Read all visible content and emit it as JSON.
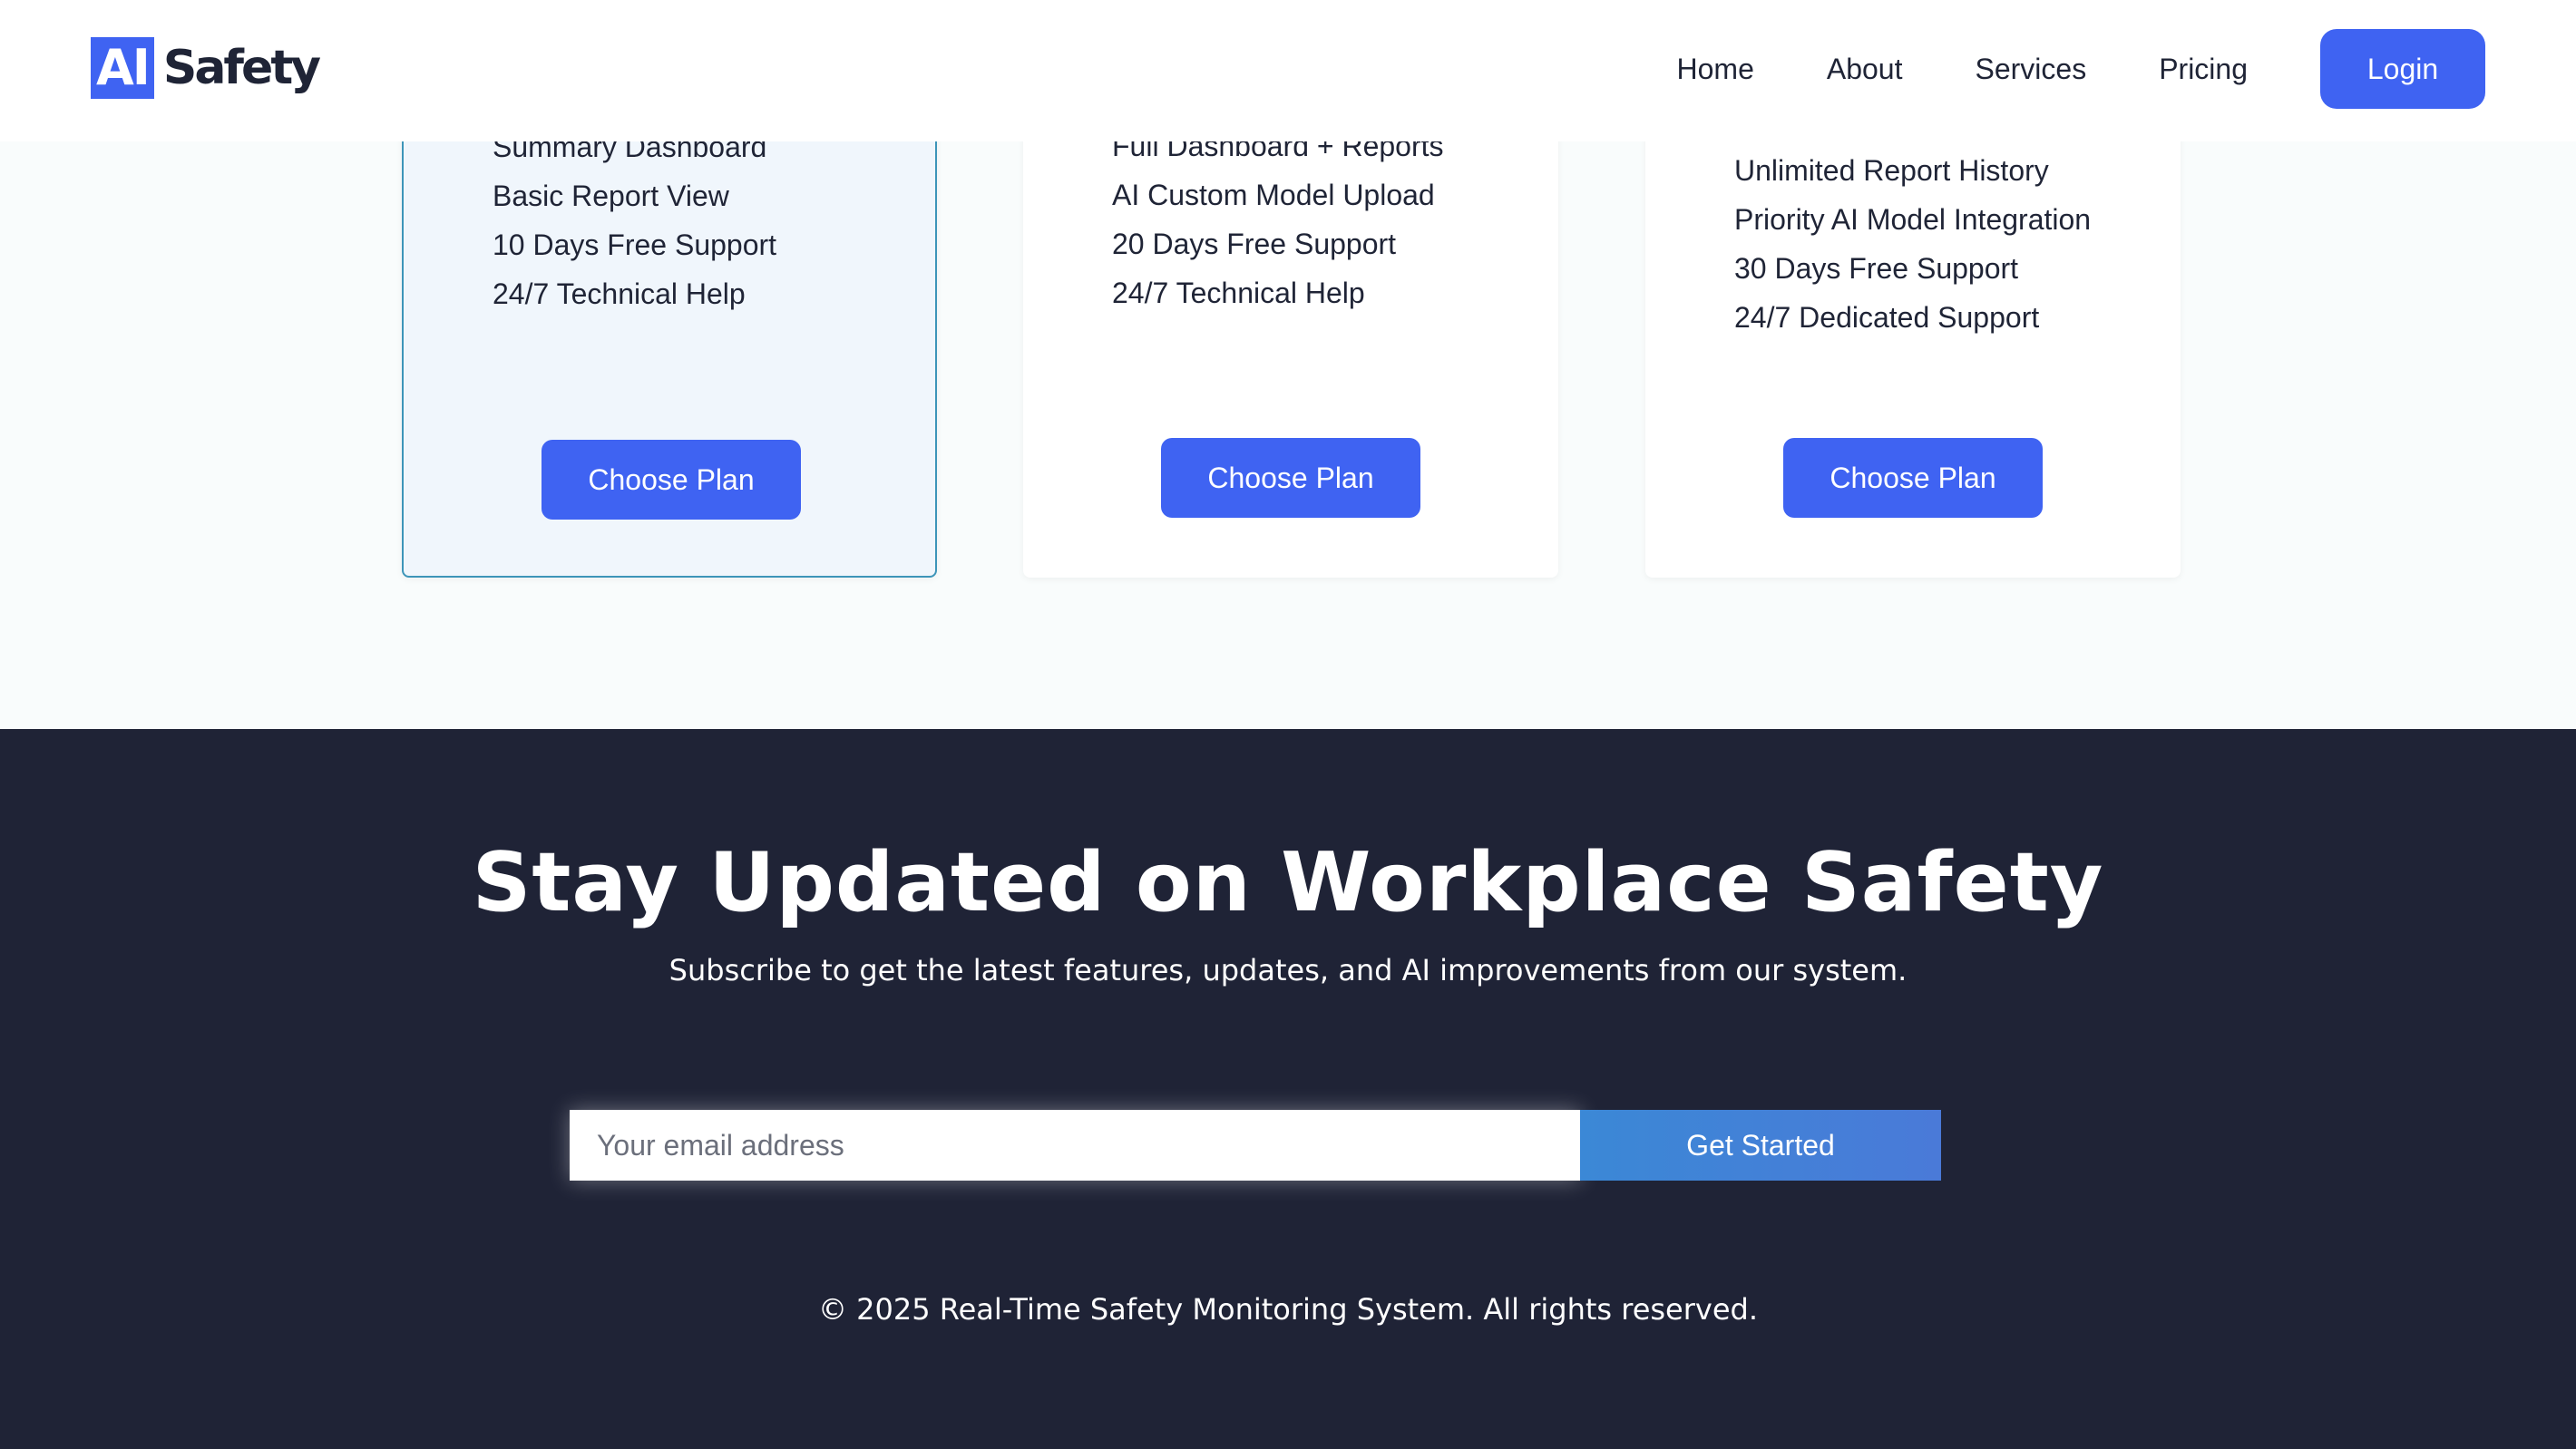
{
  "header": {
    "logo_mark": "AI",
    "logo_text": "Safety",
    "nav": [
      "Home",
      "About",
      "Services",
      "Pricing"
    ],
    "login_label": "Login"
  },
  "pricing": {
    "plans": [
      {
        "features": [
          "Summary Dashboard",
          "Basic Report View",
          "10 Days Free Support",
          "24/7 Technical Help"
        ],
        "button_label": "Choose Plan",
        "highlighted": true
      },
      {
        "features": [
          "Full Dashboard + Reports",
          "AI Custom Model Upload",
          "20 Days Free Support",
          "24/7 Technical Help"
        ],
        "button_label": "Choose Plan",
        "highlighted": false
      },
      {
        "features": [
          "Unlimited Report History",
          "Priority AI Model Integration",
          "30 Days Free Support",
          "24/7 Dedicated Support"
        ],
        "button_label": "Choose Plan",
        "highlighted": false
      }
    ]
  },
  "newsletter": {
    "title": "Stay Updated on Workplace Safety",
    "subtitle": "Subscribe to get the latest features, updates, and AI improvements from our system.",
    "email_placeholder": "Your email address",
    "email_value": "",
    "submit_label": "Get Started"
  },
  "footer": {
    "copyright": "© 2025 Real-Time Safety Monitoring System. All rights reserved."
  },
  "colors": {
    "primary": "#3f63f2",
    "footer_bg": "#1f2336",
    "highlight_border": "#3d95b9",
    "highlight_bg": "#f0f6fc"
  }
}
